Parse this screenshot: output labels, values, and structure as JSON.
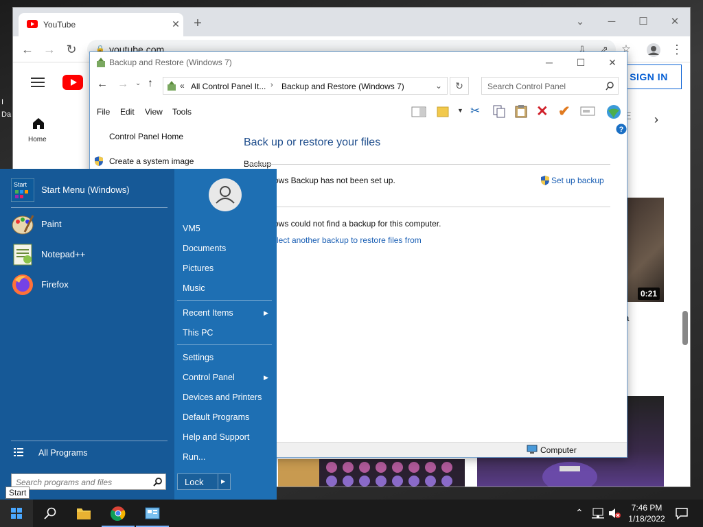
{
  "desktop": {
    "fragments": [
      "I",
      "Da"
    ]
  },
  "chrome": {
    "tab_title": "YouTube",
    "tab_close": "✕",
    "new_tab": "+",
    "url": "youtube.com",
    "controls": {
      "min": "─",
      "max": "☐",
      "close": "✕",
      "dropdown": "⌄"
    }
  },
  "youtube": {
    "sign_in": "SIGN IN",
    "home_label": "Home",
    "duration": "0:21",
    "video_title_fragment": "n a"
  },
  "explorer": {
    "title": "Backup and Restore (Windows 7)",
    "breadcrumb": [
      "All Control Panel It...",
      "Backup and Restore (Windows 7)"
    ],
    "breadcrumb_prefix": "«",
    "search_placeholder": "Search Control Panel",
    "menu": [
      "File",
      "Edit",
      "View",
      "Tools"
    ],
    "left_links": [
      "Control Panel Home",
      "Create a system image"
    ],
    "heading": "Back up or restore your files",
    "backup_section": "Backup",
    "backup_status": "ows Backup has not been set up.",
    "setup_link": "Set up backup",
    "restore_status": "ows could not find a backup for this computer.",
    "restore_link": "lect another backup to restore files from",
    "status_computer": "Computer"
  },
  "start_menu": {
    "pinned": [
      {
        "label": "Start Menu (Windows)",
        "icon": "start-menu-app-icon"
      },
      {
        "label": "Paint",
        "icon": "paint-icon"
      },
      {
        "label": "Notepad++",
        "icon": "notepadpp-icon"
      },
      {
        "label": "Firefox",
        "icon": "firefox-icon"
      }
    ],
    "all_programs": "All Programs",
    "search_placeholder": "Search programs and files",
    "right_items": [
      "VM5",
      "Documents",
      "Pictures",
      "Music",
      "Recent Items",
      "This PC",
      "Settings",
      "Control Panel",
      "Devices and Printers",
      "Default Programs",
      "Help and Support",
      "Run..."
    ],
    "lock": "Lock",
    "tooltip": "Start"
  },
  "taskbar": {
    "time": "7:46 PM",
    "date": "1/18/2022"
  },
  "colors": {
    "start_menu_bg": "#1e6fb3",
    "explorer_heading": "#1e4d8c",
    "link": "#1a5fb4",
    "taskbar": "#1b1b1b",
    "youtube_red": "#ff0000",
    "signin_blue": "#065fd4"
  }
}
